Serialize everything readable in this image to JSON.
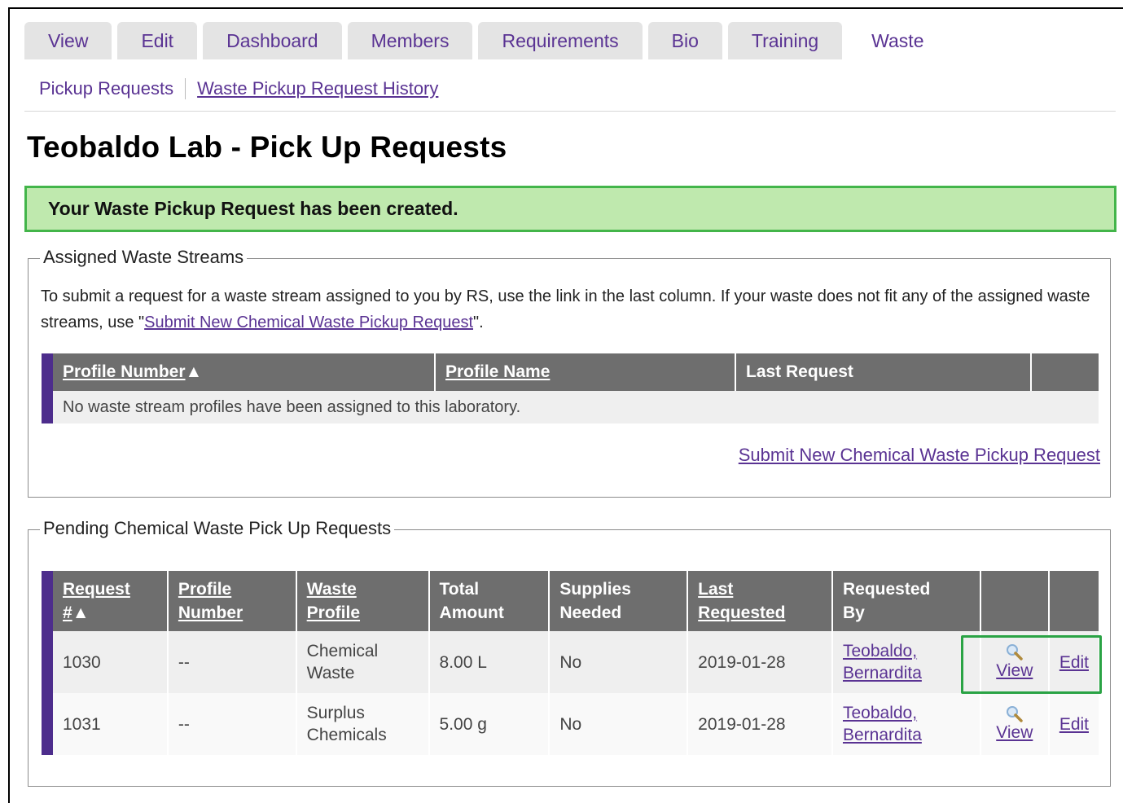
{
  "tabs": [
    {
      "label": "View"
    },
    {
      "label": "Edit"
    },
    {
      "label": "Dashboard"
    },
    {
      "label": "Members"
    },
    {
      "label": "Requirements"
    },
    {
      "label": "Bio"
    },
    {
      "label": "Training"
    },
    {
      "label": "Waste",
      "active": true
    }
  ],
  "subnav": {
    "pickup_requests": "Pickup Requests",
    "history": "Waste Pickup Request History"
  },
  "page_title": "Teobaldo Lab - Pick Up Requests",
  "alert": "Your Waste Pickup Request has been created.",
  "assigned": {
    "legend": "Assigned Waste Streams",
    "intro_before": "To submit a request for a waste stream assigned to you by RS, use the link in the last column. If your waste does not fit any of the assigned waste streams, use \"",
    "intro_link": "Submit New Chemical Waste Pickup Request",
    "intro_after": "\".",
    "columns": {
      "profile_number": "Profile Number",
      "sort_arrow": "▲",
      "profile_name": "Profile Name",
      "last_request": "Last Request"
    },
    "empty_message": "No waste stream profiles have been assigned to this laboratory.",
    "submit_link": "Submit New Chemical Waste Pickup Request"
  },
  "pending": {
    "legend": "Pending Chemical Waste Pick Up Requests",
    "columns": {
      "request_l1": "Request",
      "request_l2": "#",
      "sort_arrow": "▲",
      "profile_number_l1": "Profile",
      "profile_number_l2": "Number",
      "waste_profile_l1": "Waste",
      "waste_profile_l2": "Profile",
      "total_amount_l1": "Total",
      "total_amount_l2": "Amount",
      "supplies_l1": "Supplies",
      "supplies_l2": "Needed",
      "last_requested_l1": "Last",
      "last_requested_l2": "Requested",
      "requested_by_l1": "Requested",
      "requested_by_l2": "By"
    },
    "rows": [
      {
        "request": "1030",
        "profile_number": "--",
        "waste_profile_l1": "Chemical",
        "waste_profile_l2": "Waste",
        "total_amount": "8.00 L",
        "supplies": "No",
        "last_requested": "2019-01-28",
        "requested_by_l1": "Teobaldo,",
        "requested_by_l2": "Bernardita",
        "view": "View",
        "edit": "Edit"
      },
      {
        "request": "1031",
        "profile_number": "--",
        "waste_profile_l1": "Surplus",
        "waste_profile_l2": "Chemicals",
        "total_amount": "5.00 g",
        "supplies": "No",
        "last_requested": "2019-01-28",
        "requested_by_l1": "Teobaldo,",
        "requested_by_l2": "Bernardita",
        "view": "View",
        "edit": "Edit"
      }
    ]
  },
  "colors": {
    "link": "#5a3393",
    "row_accent": "#4d2d8c",
    "header_bg": "#6e6e6e",
    "alert_bg": "#bfe9ae",
    "alert_border": "#43b54a",
    "highlight_border": "#2aa345"
  }
}
